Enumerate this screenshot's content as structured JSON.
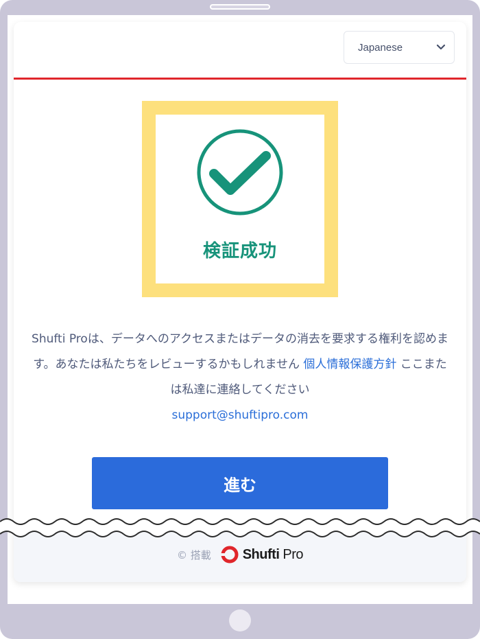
{
  "header": {
    "language": {
      "selected": "Japanese"
    }
  },
  "success": {
    "title": "検証成功"
  },
  "message": {
    "text": "Shufti Proは、データへのアクセスまたはデータの消去を要求する権利を認めます。あなたは私たちをレビューするかもしれません ",
    "privacy_link": "個人情報保護方針",
    "after_link": " ここまたは私達に連絡してください",
    "email": "support@shuftipro.com"
  },
  "actions": {
    "proceed_label": "進む"
  },
  "footer": {
    "powered_by": "© 搭載",
    "brand_first": "Shufti",
    "brand_second": " Pro"
  },
  "colors": {
    "accent_red": "#e0262b",
    "success_green": "#17937a",
    "highlight_yellow": "#fde07d",
    "button_blue": "#2b6bdb",
    "link_blue": "#2a6ed8"
  },
  "icons": [
    "chevron-down-icon",
    "check-circle-icon",
    "shufti-pro-logo-icon"
  ]
}
